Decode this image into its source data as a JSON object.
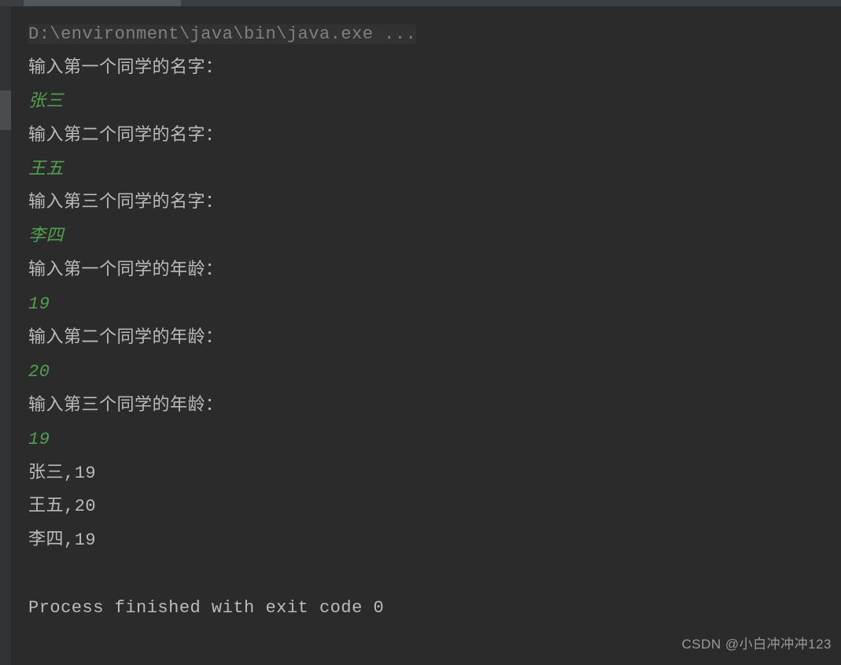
{
  "console": {
    "command_line": "D:\\environment\\java\\bin\\java.exe ...",
    "lines": [
      {
        "type": "output",
        "text": "输入第一个同学的名字："
      },
      {
        "type": "input",
        "text": "张三"
      },
      {
        "type": "output",
        "text": "输入第二个同学的名字："
      },
      {
        "type": "input",
        "text": "王五"
      },
      {
        "type": "output",
        "text": "输入第三个同学的名字："
      },
      {
        "type": "input",
        "text": "李四"
      },
      {
        "type": "output",
        "text": "输入第一个同学的年龄："
      },
      {
        "type": "input",
        "text": "19"
      },
      {
        "type": "output",
        "text": "输入第二个同学的年龄："
      },
      {
        "type": "input",
        "text": "20"
      },
      {
        "type": "output",
        "text": "输入第三个同学的年龄："
      },
      {
        "type": "input",
        "text": "19"
      },
      {
        "type": "output",
        "text": "张三,19"
      },
      {
        "type": "output",
        "text": "王五,20"
      },
      {
        "type": "output",
        "text": "李四,19"
      }
    ],
    "exit_message": "Process finished with exit code 0"
  },
  "watermark": "CSDN @小白冲冲冲123"
}
